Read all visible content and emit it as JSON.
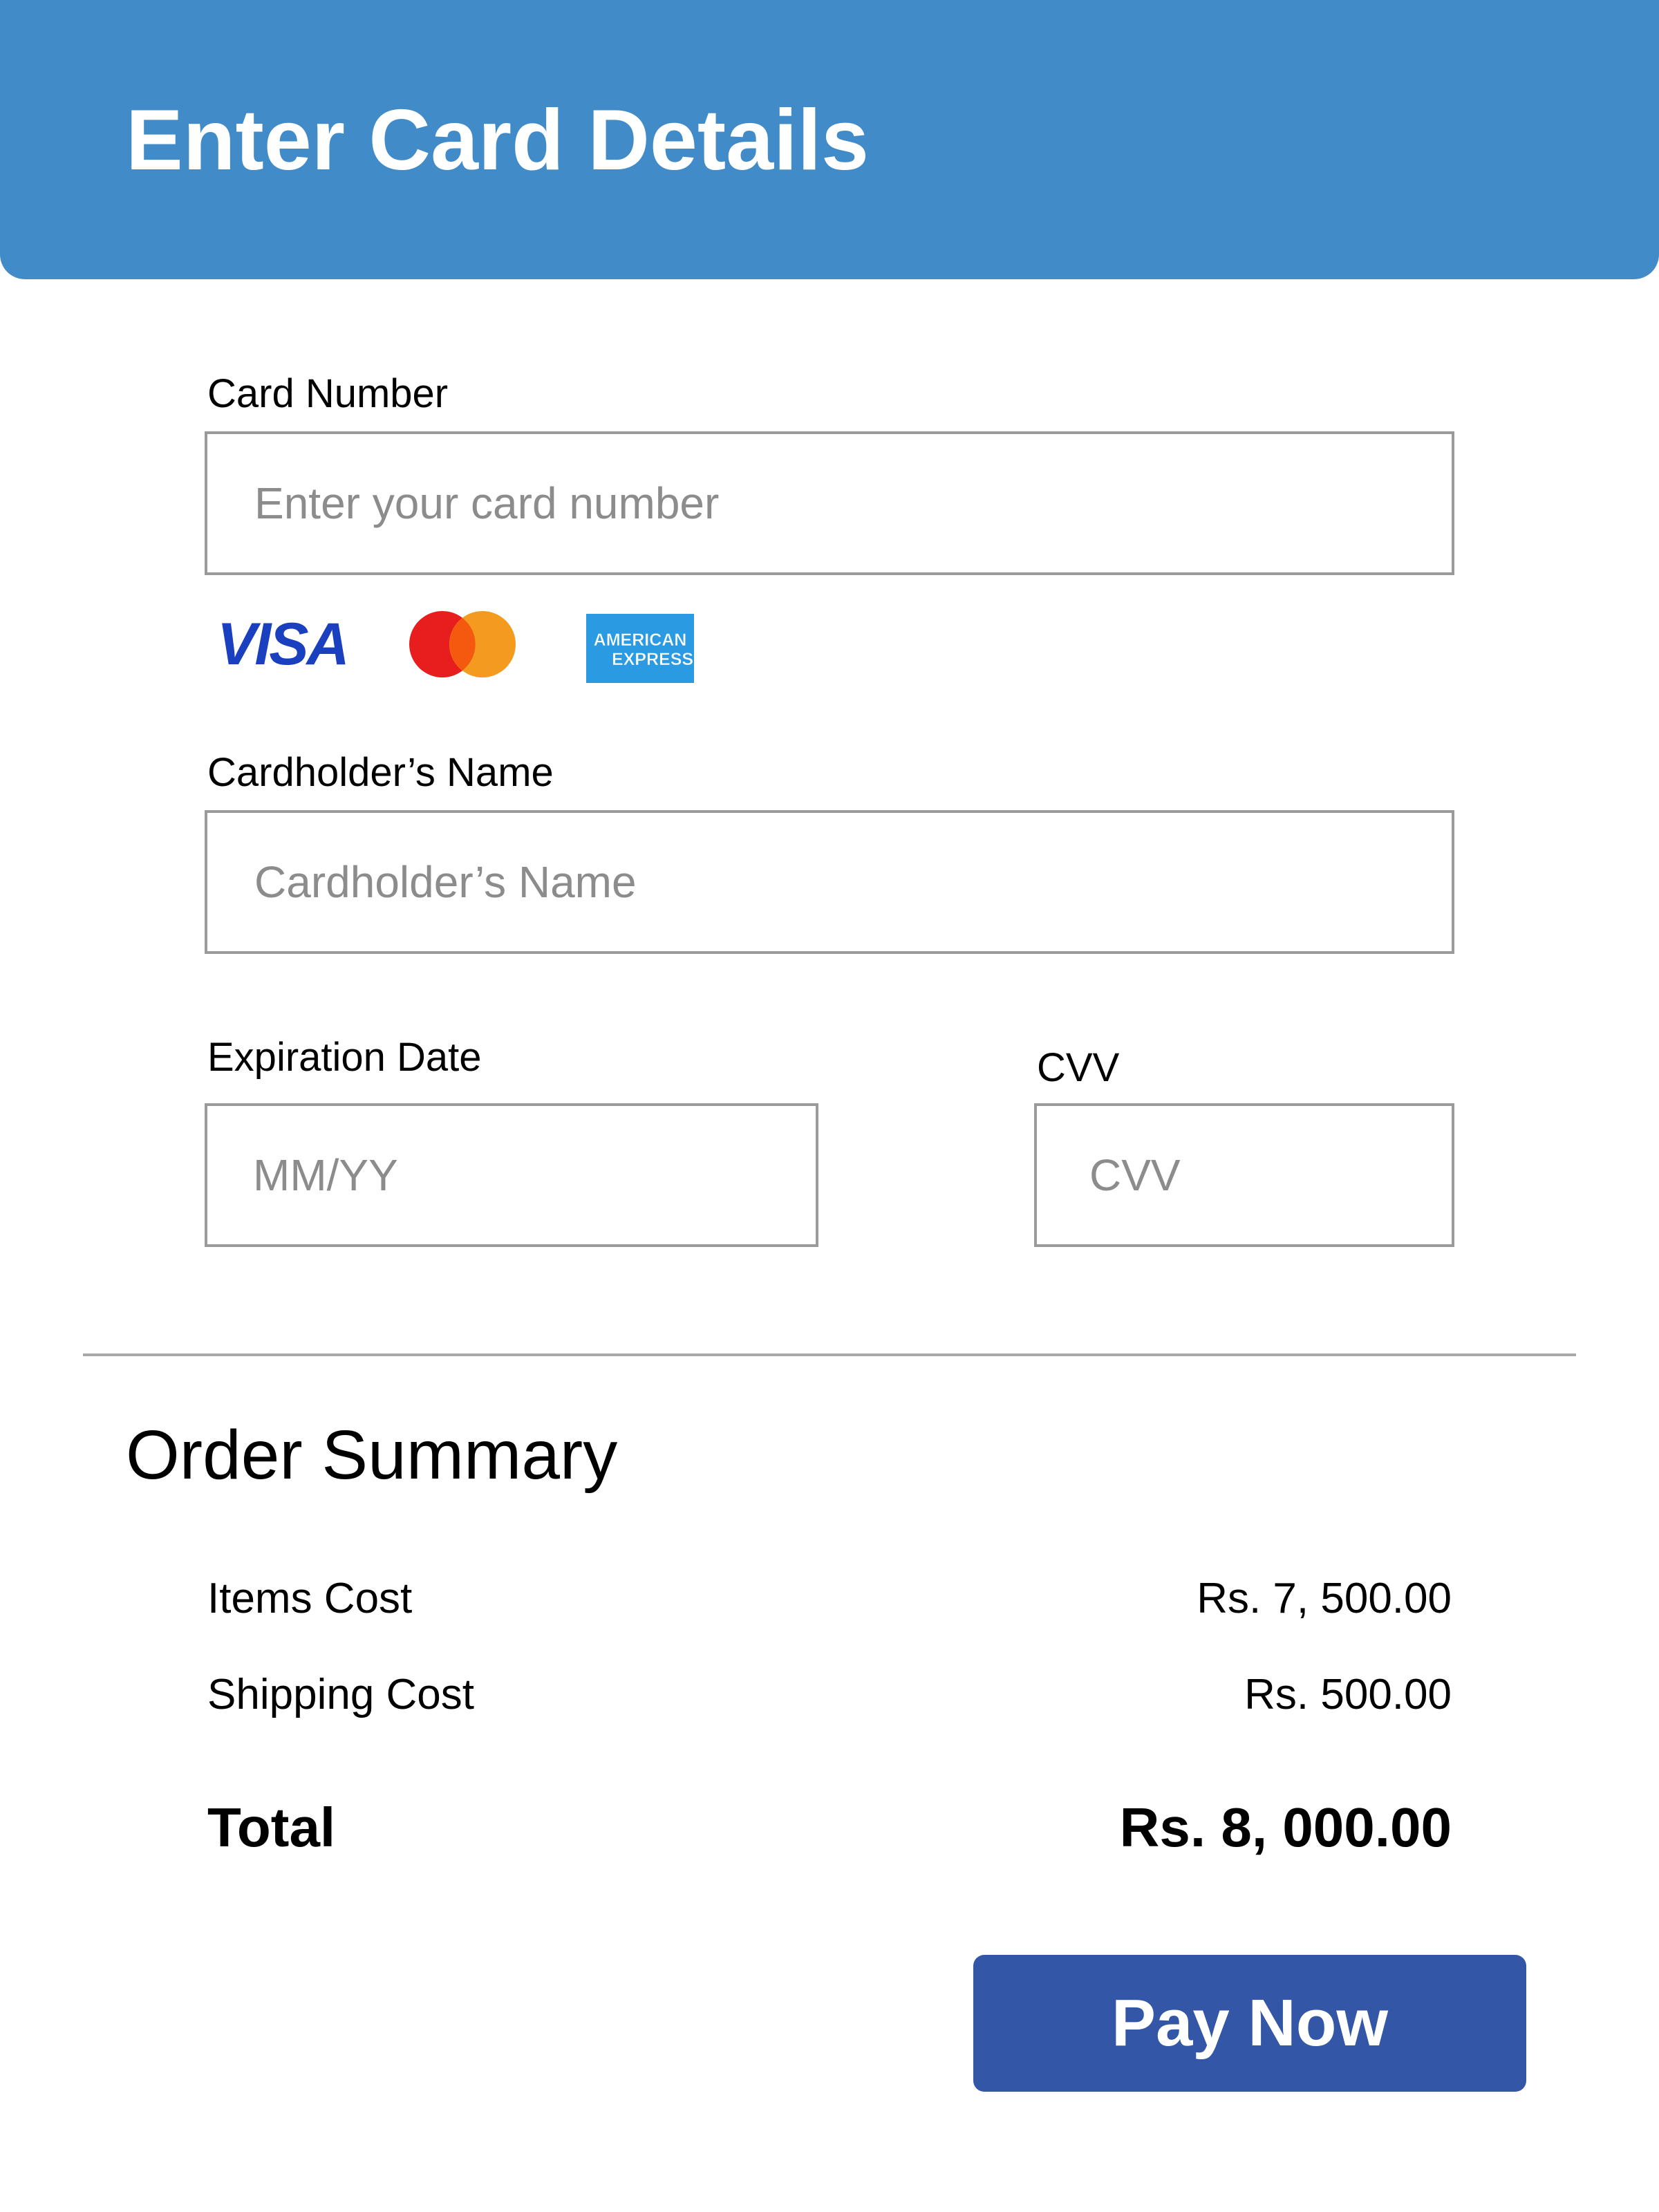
{
  "header": {
    "title": "Enter Card Details",
    "background_color": "#428BC9"
  },
  "card_form": {
    "card_number": {
      "label": "Card Number",
      "placeholder": "Enter your card number",
      "value": ""
    },
    "accepted_cards": {
      "visa": "VISA",
      "mastercard": "mastercard-icon",
      "amex_line1": "AMERICAN",
      "amex_line2": "EXPRESS"
    },
    "cardholder_name": {
      "label": "Cardholder’s Name",
      "placeholder": "Cardholder’s Name",
      "value": ""
    },
    "expiration_date": {
      "label": "Expiration Date",
      "placeholder": "MM/YY",
      "value": ""
    },
    "cvv": {
      "label": "CVV",
      "placeholder": "CVV",
      "value": ""
    }
  },
  "order_summary": {
    "title": "Order Summary",
    "items_cost_label": "Items Cost",
    "items_cost_value": "Rs. 7, 500.00",
    "shipping_cost_label": "Shipping Cost",
    "shipping_cost_value": "Rs. 500.00",
    "total_label": "Total",
    "total_value": "Rs. 8, 000.00"
  },
  "actions": {
    "pay_now_label": "Pay Now",
    "button_color": "#3456A6"
  }
}
